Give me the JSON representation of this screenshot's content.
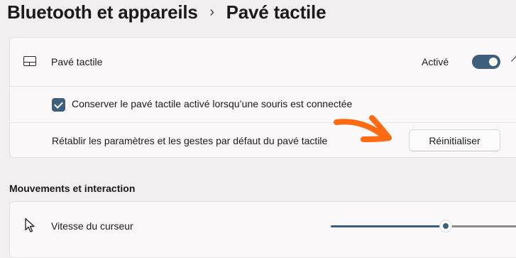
{
  "breadcrumb": {
    "parent": "Bluetooth et appareils",
    "separator": "›",
    "current": "Pavé tactile"
  },
  "touchpad_card": {
    "title": "Pavé tactile",
    "state_label": "Activé",
    "toggle_on": true,
    "expanded": true,
    "keep_on_label": "Conserver le pavé tactile activé lorsqu’une souris est connectée",
    "keep_on_checked": true,
    "reset_description": "Rétablir les paramètres et les gestes par défaut du pavé tactile",
    "reset_button": "Réinitialiser"
  },
  "annotation": {
    "type": "hand-drawn arrow",
    "color": "#ff6a13"
  },
  "movement_section": {
    "heading": "Mouvements et interaction",
    "cursor_speed_label": "Vitesse du curseur",
    "cursor_speed_fraction": 0.6
  },
  "icons": {
    "touchpad": "touchpad-icon",
    "cursor": "mouse-pointer-icon",
    "expand": "chevron-up-icon"
  },
  "colors": {
    "accent": "#3d5f7d",
    "background": "#f3eeef",
    "card": "#fbf8f9",
    "arrow": "#ff6a13"
  }
}
